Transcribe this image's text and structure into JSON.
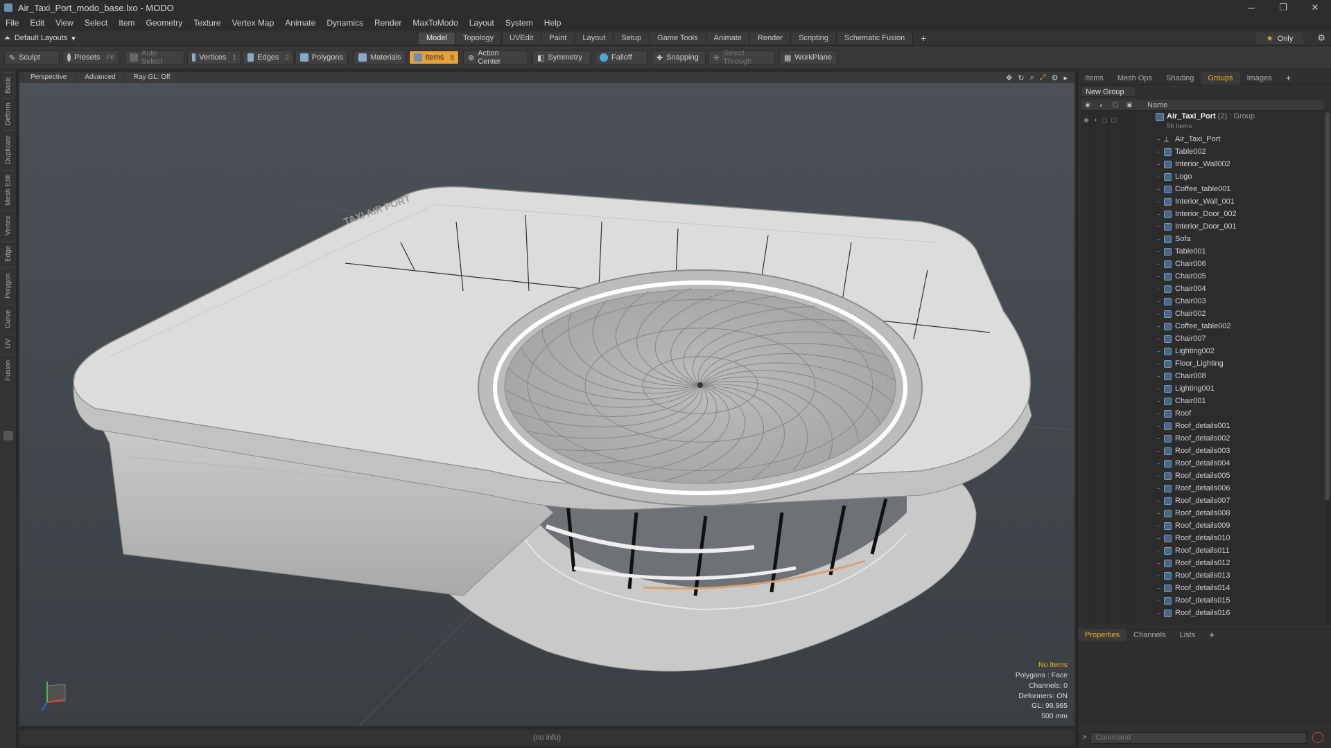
{
  "window": {
    "title": "Air_Taxi_Port_modo_base.lxo - MODO",
    "minimize": "─",
    "maximize": "❐",
    "close": "✕"
  },
  "menu": [
    "File",
    "Edit",
    "View",
    "Select",
    "Item",
    "Geometry",
    "Texture",
    "Vertex Map",
    "Animate",
    "Dynamics",
    "Render",
    "MaxToModo",
    "Layout",
    "System",
    "Help"
  ],
  "layout_selector": "Default Layouts",
  "mode_tabs": [
    "Model",
    "Topology",
    "UVEdit",
    "Paint",
    "Layout",
    "Setup",
    "Game Tools",
    "Animate",
    "Render",
    "Scripting",
    "Schematic Fusion"
  ],
  "mode_active": "Model",
  "only_label": "Only",
  "toolbar": {
    "sculpt": "Sculpt",
    "presets": "Presets",
    "presets_key": "F6",
    "auto_select": "Auto Select",
    "vertices": "Vertices",
    "vertices_key": "1",
    "edges": "Edges",
    "edges_key": "2",
    "polygons": "Polygons",
    "materials": "Materials",
    "items": "Items",
    "items_key": "5",
    "action_center": "Action Center",
    "symmetry": "Symmetry",
    "falloff": "Falloff",
    "snapping": "Snapping",
    "select_through": "Select Through",
    "workplane": "WorkPlane"
  },
  "left_tabs": [
    "Basic",
    "Deform",
    "Duplicate",
    "Mesh Edit",
    "Vertex",
    "Edge",
    "Polygon",
    "Curve",
    "UV",
    "Fusion"
  ],
  "viewport": {
    "view": "Perspective",
    "shading": "Advanced",
    "raygl": "Ray GL: Off",
    "info": {
      "no_items": "No Items",
      "polygons": "Polygons : Face",
      "channels": "Channels: 0",
      "deformers": "Deformers: ON",
      "gl": "GL: 99,965",
      "scale": "500 mm"
    }
  },
  "status_bar": "(no info)",
  "right_panel": {
    "tabs": [
      "Items",
      "Mesh Ops",
      "Shading",
      "Groups",
      "Images"
    ],
    "active_tab": "Groups",
    "new_group": "New Group",
    "name_header": "Name",
    "group": {
      "name": "Air_Taxi_Port",
      "suffix": "(2) : Group",
      "count": "56 Items"
    },
    "items": [
      "Air_Taxi_Port",
      "Table002",
      "Interior_Wall002",
      "Logo",
      "Coffee_table001",
      "Interior_Wall_001",
      "Interior_Door_002",
      "Interior_Door_001",
      "Sofa",
      "Table001",
      "Chair006",
      "Chair005",
      "Chair004",
      "Chair003",
      "Chair002",
      "Coffee_table002",
      "Chair007",
      "Lighting002",
      "Floor_Lighting",
      "Chair008",
      "Lighting001",
      "Chair001",
      "Roof",
      "Roof_details001",
      "Roof_details002",
      "Roof_details003",
      "Roof_details004",
      "Roof_details005",
      "Roof_details006",
      "Roof_details007",
      "Roof_details008",
      "Roof_details009",
      "Roof_details010",
      "Roof_details011",
      "Roof_details012",
      "Roof_details013",
      "Roof_details014",
      "Roof_details015",
      "Roof_details016"
    ],
    "props_tabs": [
      "Properties",
      "Channels",
      "Lists"
    ],
    "props_active": "Properties",
    "command_placeholder": "Command"
  }
}
